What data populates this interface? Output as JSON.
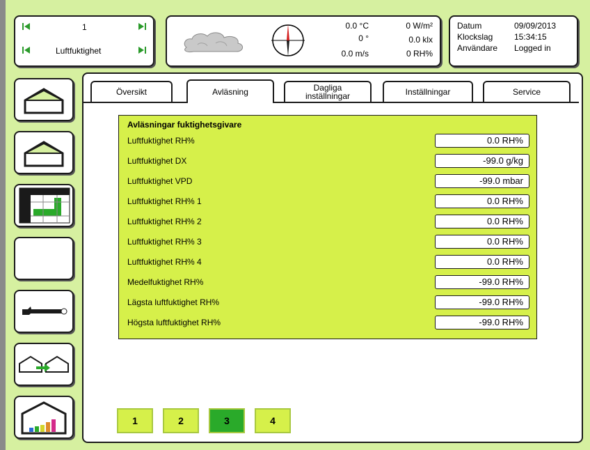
{
  "header": {
    "selector": {
      "number": "1",
      "title": "Luftfuktighet",
      "prev_icon": "skip-back-icon",
      "next_icon": "skip-forward-icon"
    },
    "weather": {
      "temperature": "0.0 °C",
      "wind_direction": "0 °",
      "wind_speed": "0.0 m/s",
      "radiation": "0 W/m²",
      "light": "0.0 klx",
      "humidity": "0 RH%"
    },
    "info": {
      "date_label": "Datum",
      "date_value": "09/09/2013",
      "time_label": "Klockslag",
      "time_value": "15:34:15",
      "user_label": "Användare",
      "user_value": "Logged in"
    }
  },
  "tabs": [
    {
      "label": "Översikt"
    },
    {
      "label": "Avläsning",
      "active": true
    },
    {
      "label_line1": "Dagliga",
      "label_line2": "inställningar"
    },
    {
      "label": "Inställningar"
    },
    {
      "label": "Service"
    }
  ],
  "panel": {
    "title": "Avläsningar fuktighetsgivare",
    "rows": [
      {
        "label": "Luftfuktighet RH%",
        "value": "0.0 RH%"
      },
      {
        "label": "Luftfuktighet DX",
        "value": "-99.0 g/kg"
      },
      {
        "label": "Luftfuktighet VPD",
        "value": "-99.0 mbar"
      },
      {
        "label": "Luftfuktighet RH% 1",
        "value": "0.0 RH%"
      },
      {
        "label": "Luftfuktighet RH% 2",
        "value": "0.0 RH%"
      },
      {
        "label": "Luftfuktighet RH% 3",
        "value": "0.0 RH%"
      },
      {
        "label": "Luftfuktighet RH% 4",
        "value": "0.0 RH%"
      },
      {
        "label": "Medelfuktighet RH%",
        "value": "-99.0 RH%"
      },
      {
        "label": "Lägsta luftfuktighet RH%",
        "value": "-99.0 RH%"
      },
      {
        "label": "Högsta luftfuktighet RH%",
        "value": "-99.0 RH%"
      }
    ]
  },
  "pages": [
    {
      "label": "1"
    },
    {
      "label": "2"
    },
    {
      "label": "3",
      "active": true
    },
    {
      "label": "4"
    }
  ],
  "sidebar": [
    {
      "icon": "greenhouse-icon"
    },
    {
      "icon": "greenhouse-icon"
    },
    {
      "icon": "chart-table-icon"
    },
    {
      "icon": "blank-icon"
    },
    {
      "icon": "wrench-icon"
    },
    {
      "icon": "greenhouses-arrow-icon"
    },
    {
      "icon": "greenhouse-bar-chart-icon"
    }
  ],
  "colors": {
    "background": "#d6f0a0",
    "panel": "#d6f04a",
    "active_page": "#2aaa2a"
  }
}
